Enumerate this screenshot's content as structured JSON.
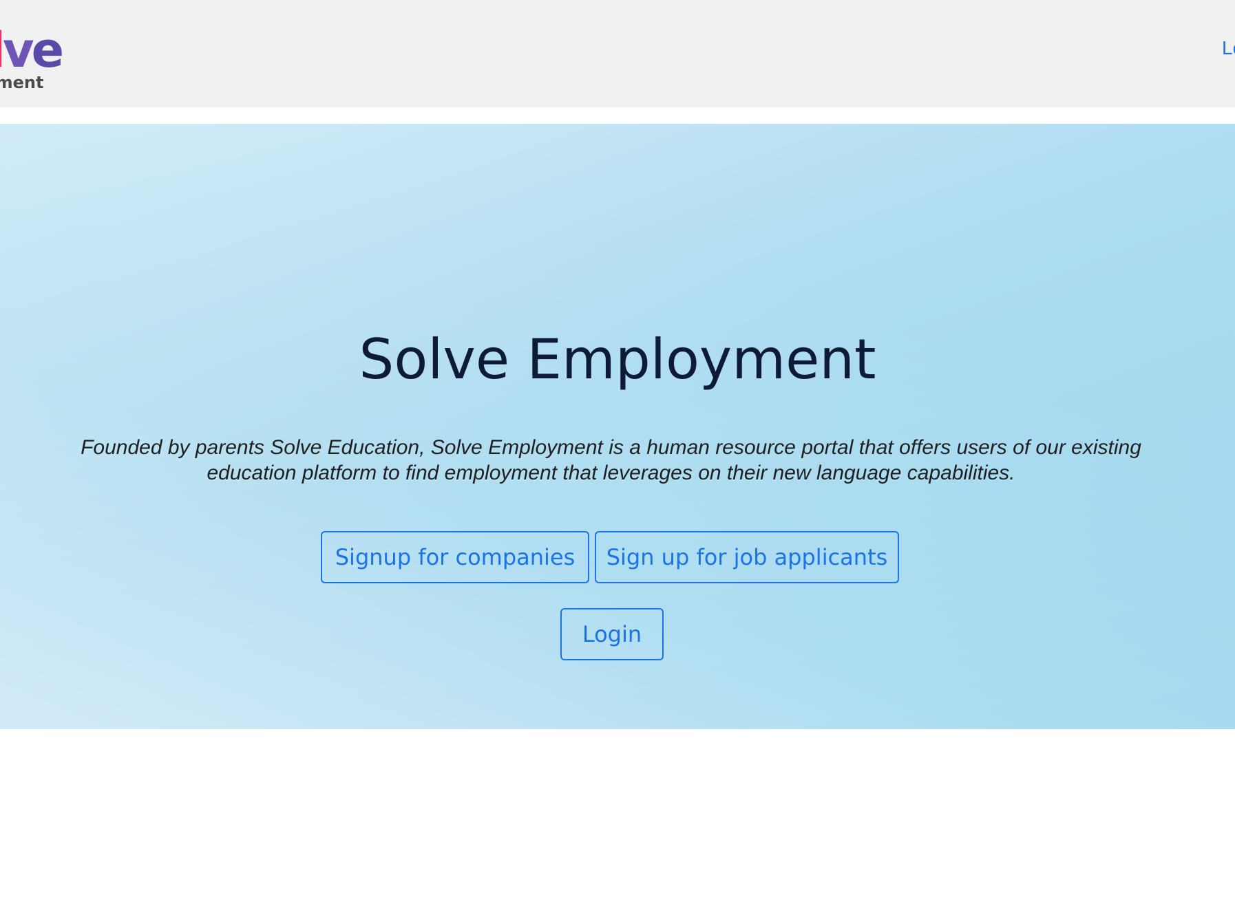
{
  "navbar": {
    "logo": {
      "word_visible": "lve",
      "sub_visible": "yment"
    },
    "login_link_partial": "Lo"
  },
  "hero": {
    "title": "Solve Employment",
    "description": "Founded by parents Solve Education, Solve Employment is a human resource portal that offers users of our existing education platform to find employment that leverages on their new language capabilities.",
    "buttons": {
      "companies": "Signup for companies",
      "applicants": "Sign up for job applicants",
      "login": "Login"
    }
  },
  "colors": {
    "navbar_bg": "#f1f1f1",
    "accent": "#1a73e8",
    "title": "#0d1b36",
    "hero_bg": "#aedcf0"
  }
}
